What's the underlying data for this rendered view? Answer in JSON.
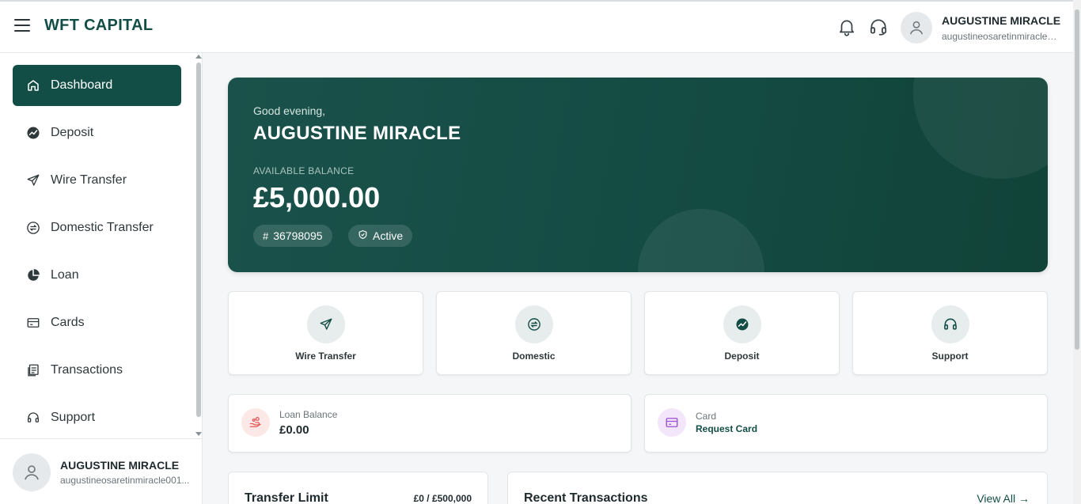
{
  "header": {
    "brand": "WFT CAPITAL",
    "user_name": "AUGUSTINE MIRACLE",
    "user_email": "augustineosaretinmiracle0..."
  },
  "sidebar": {
    "items": [
      {
        "label": "Dashboard",
        "icon": "home-icon",
        "active": true
      },
      {
        "label": "Deposit",
        "icon": "trending-up-icon"
      },
      {
        "label": "Wire Transfer",
        "icon": "send-icon"
      },
      {
        "label": "Domestic Transfer",
        "icon": "exchange-icon"
      },
      {
        "label": "Loan",
        "icon": "pie-chart-icon"
      },
      {
        "label": "Cards",
        "icon": "card-icon"
      },
      {
        "label": "Transactions",
        "icon": "receipt-icon"
      },
      {
        "label": "Support",
        "icon": "headset-icon"
      }
    ],
    "user_name": "AUGUSTINE MIRACLE",
    "user_email": "augustineosaretinmiracle001..."
  },
  "hero": {
    "greeting": "Good evening,",
    "name": "AUGUSTINE MIRACLE",
    "balance_label": "AVAILABLE BALANCE",
    "balance": "£5,000.00",
    "account_number": "36798095",
    "status": "Active"
  },
  "quick_actions": [
    {
      "label": "Wire Transfer",
      "icon": "send-icon"
    },
    {
      "label": "Domestic",
      "icon": "exchange-icon"
    },
    {
      "label": "Deposit",
      "icon": "trending-up-icon"
    },
    {
      "label": "Support",
      "icon": "headset-icon"
    }
  ],
  "loan": {
    "label": "Loan Balance",
    "value": "£0.00"
  },
  "card": {
    "label": "Card",
    "value": "Request Card"
  },
  "transfer_limit": {
    "title": "Transfer Limit",
    "value": "£0 / £500,000"
  },
  "recent": {
    "title": "Recent Transactions",
    "view_all": "View All"
  },
  "colors": {
    "brand": "#134e46",
    "loan_accent": "#e25b5b",
    "card_accent": "#9b4fd1"
  }
}
